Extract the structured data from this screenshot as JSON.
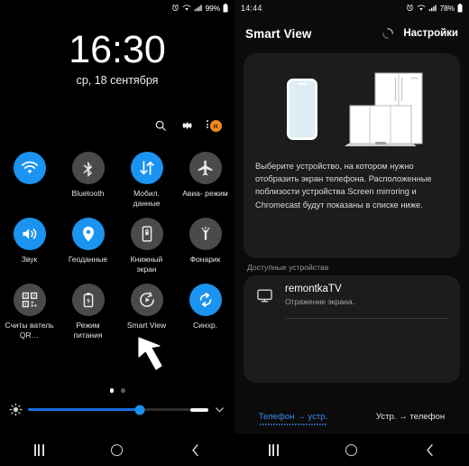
{
  "left_panel": {
    "statusbar": {
      "icons": [
        "alarm-icon",
        "wifi-icon",
        "signal-icon"
      ],
      "battery_percent": "99%",
      "battery_icon": "battery-icon"
    },
    "lockscreen": {
      "time": "16:30",
      "date": "ср, 18 сентября"
    },
    "quick_actions": [
      {
        "name": "search-icon",
        "label": "Поиск"
      },
      {
        "name": "gear-icon",
        "label": "Настройки"
      },
      {
        "name": "overflow-menu-icon",
        "label": "Меню",
        "badge": "н"
      }
    ],
    "toggles": [
      [
        {
          "label": "",
          "icon": "wifi-icon",
          "state": "on"
        },
        {
          "label": "Bluetooth",
          "icon": "bluetooth-icon",
          "state": "off"
        },
        {
          "label": "Мобил. данные",
          "icon": "data-transfer-icon",
          "state": "on"
        },
        {
          "label": "Авиа- режим",
          "icon": "airplane-icon",
          "state": "off"
        }
      ],
      [
        {
          "label": "Звук",
          "icon": "sound-icon",
          "state": "on"
        },
        {
          "label": "Геоданные",
          "icon": "location-pin-icon",
          "state": "on"
        },
        {
          "label": "Книжный экран",
          "icon": "rotation-lock-icon",
          "state": "off"
        },
        {
          "label": "Фонарик",
          "icon": "flashlight-icon",
          "state": "off"
        }
      ],
      [
        {
          "label": "Считы ватель QR…",
          "icon": "qr-code-icon",
          "state": "off"
        },
        {
          "label": "Режим питания",
          "icon": "power-mode-icon",
          "state": "off"
        },
        {
          "label": "Smart View",
          "icon": "smart-view-icon",
          "state": "off"
        },
        {
          "label": "Синхр.",
          "icon": "sync-icon",
          "state": "on"
        }
      ]
    ],
    "page_dots": {
      "total": 2,
      "active_index": 0
    },
    "brightness": {
      "icon": "brightness-sun-icon",
      "value_percent": 62,
      "expand_icon": "chevron-down-icon"
    },
    "navbar": [
      {
        "name": "recents-button",
        "icon": "recents-icon"
      },
      {
        "name": "home-button",
        "icon": "home-circle-icon"
      },
      {
        "name": "back-button",
        "icon": "back-chevron-icon"
      }
    ]
  },
  "right_panel": {
    "statusbar": {
      "clock": "14:44",
      "icons": [
        "alarm-icon",
        "wifi-icon",
        "signal-icon"
      ],
      "battery_percent": "78%",
      "battery_icon": "battery-icon"
    },
    "header": {
      "title": "Smart View",
      "spinner_icon": "loading-spinner-icon",
      "settings_label": "Настройки"
    },
    "illustration": {
      "name": "phone-to-tv-illustration",
      "items": [
        "phone-outline",
        "tv-outline",
        "refrigerator-outline"
      ]
    },
    "description": "Выберите устройство, на котором нужно отобразить экран телефона. Расположенные поблизости устройства Screen mirroring и Chromecast будут показаны в списке ниже.",
    "available_devices_label": "Доступные устройства",
    "devices": [
      {
        "name": "remontkaTV",
        "subtitle": "Отражение экрана.",
        "icon": "monitor-icon"
      }
    ],
    "tabs": [
      {
        "label": "Телефон → устр.",
        "active": true
      },
      {
        "label": "Устр. → телефон",
        "active": false
      }
    ],
    "navbar": [
      {
        "name": "recents-button",
        "icon": "recents-icon"
      },
      {
        "name": "home-button",
        "icon": "home-circle-icon"
      },
      {
        "name": "back-button",
        "icon": "back-chevron-icon"
      }
    ]
  },
  "annotations": {
    "arrows": [
      {
        "name": "pointer-arrow-smart-view",
        "target": "Smart View toggle"
      },
      {
        "name": "pointer-arrow-device",
        "target": "remontkaTV device"
      }
    ]
  },
  "colors": {
    "accent_blue": "#1a94f0",
    "tab_blue": "#3b8ef0",
    "badge_orange": "#f08a1e",
    "panel_bg": "#000000",
    "card_bg": "#1c1c1c"
  }
}
